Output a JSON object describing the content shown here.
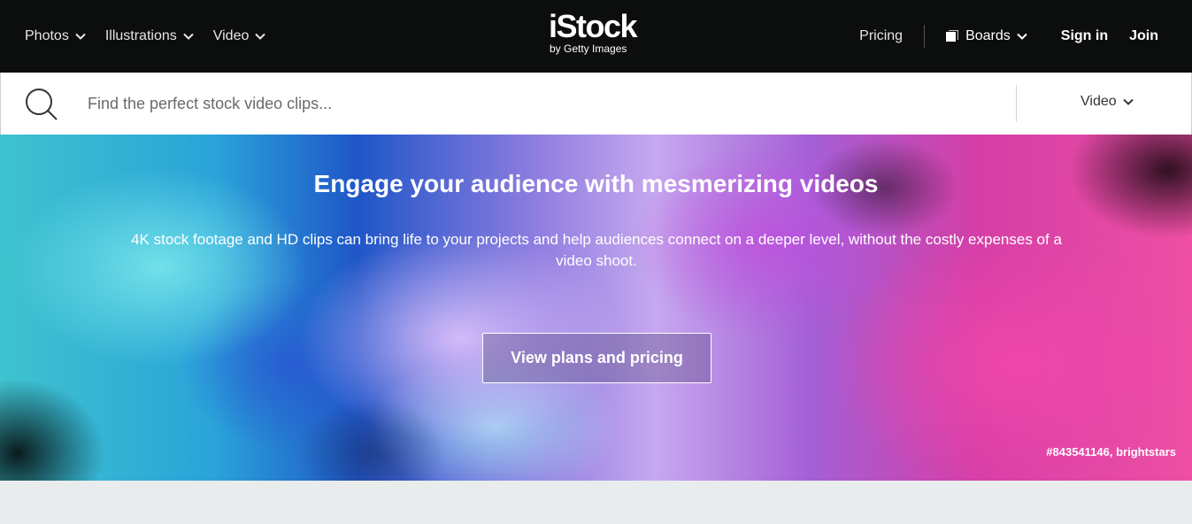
{
  "nav": {
    "items": [
      {
        "label": "Photos",
        "icon": "chevron-down-icon"
      },
      {
        "label": "Illustrations",
        "icon": "chevron-down-icon"
      },
      {
        "label": "Video",
        "icon": "chevron-down-icon"
      }
    ],
    "logo": {
      "main": "iStock",
      "sub": "by Getty Images"
    },
    "pricing": "Pricing",
    "boards": "Boards",
    "sign_in": "Sign in",
    "join": "Join"
  },
  "search": {
    "placeholder": "Find the perfect stock video clips...",
    "value": "",
    "type_label": "Video"
  },
  "hero": {
    "title": "Engage your audience with mesmerizing videos",
    "description": "4K stock footage and HD clips can bring life to your projects and help audiences connect on a deeper level, without the costly expenses of a video shoot.",
    "cta": "View plans and pricing",
    "credit": "#843541146, brightstars"
  },
  "colors": {
    "nav_background": "#0c0d0d",
    "page_background": "#e8ecec",
    "text_light": "#ffffff"
  }
}
